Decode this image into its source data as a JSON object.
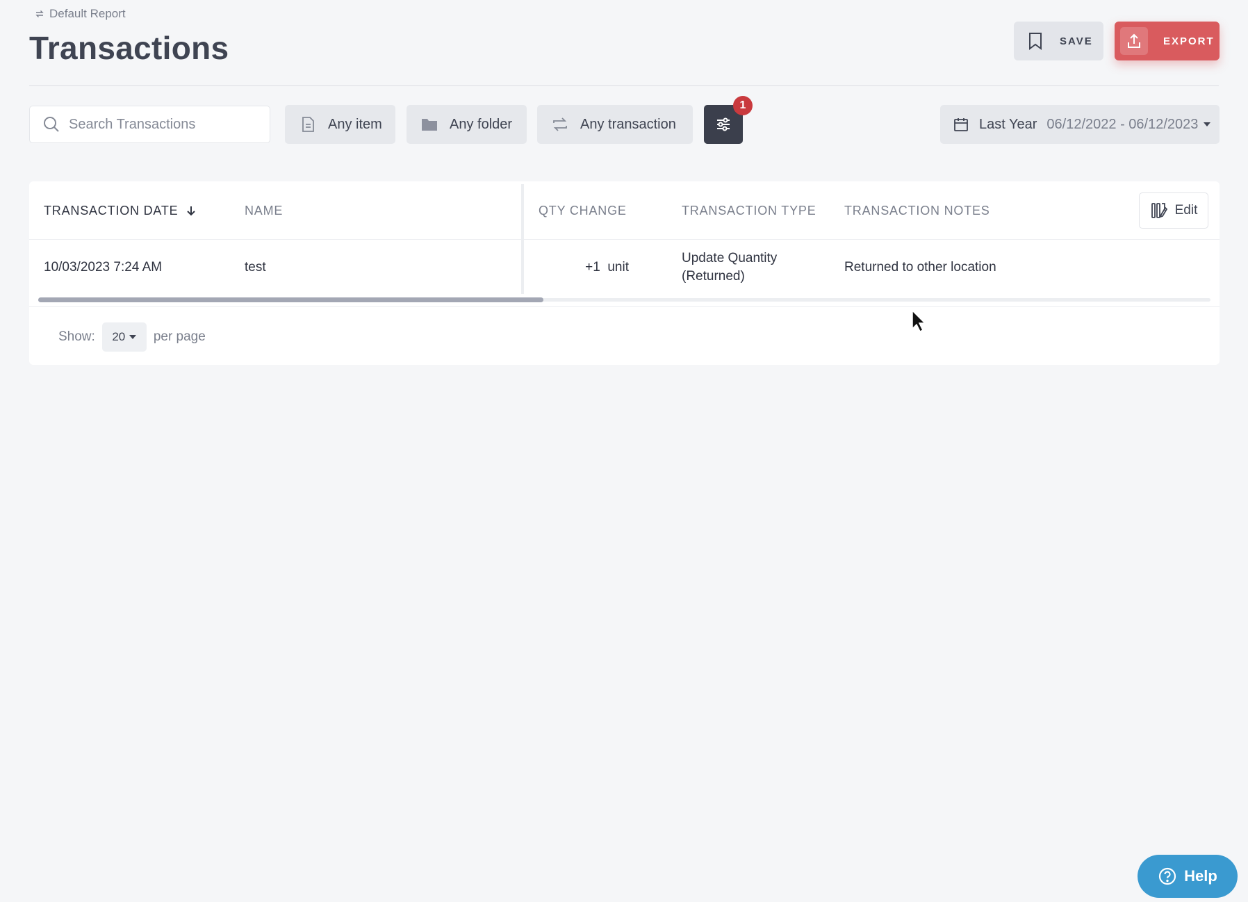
{
  "breadcrumb": {
    "icon": "refresh-icon",
    "label": "Default Report"
  },
  "page": {
    "title": "Transactions"
  },
  "actions": {
    "save_label": "SAVE",
    "export_label": "EXPORT",
    "export_color": "#d95b5e"
  },
  "filters": {
    "search_placeholder": "Search Transactions",
    "search_value": "",
    "item_label": "Any item",
    "folder_label": "Any folder",
    "transaction_label": "Any transaction",
    "active_filter_count": "1",
    "date_label": "Last Year",
    "date_range": "06/12/2022 - 06/12/2023"
  },
  "table": {
    "columns": [
      {
        "label": "TRANSACTION DATE",
        "sorted": "desc"
      },
      {
        "label": "NAME"
      },
      {
        "label": "QTY CHANGE"
      },
      {
        "label": "TRANSACTION TYPE"
      },
      {
        "label": "TRANSACTION NOTES"
      }
    ],
    "edit_label": "Edit",
    "rows": [
      {
        "date": "10/03/2023 7:24 AM",
        "name": "test",
        "qty_change": "+1  unit",
        "type_line1": "Update Quantity",
        "type_line2": "(Returned)",
        "notes": "Returned to other location"
      }
    ],
    "horizontal_scroll_fraction": 0.43
  },
  "pagination": {
    "show_label": "Show:",
    "page_size": "20",
    "per_page_label": "per page"
  },
  "help": {
    "label": "Help",
    "color": "#3a9ad0"
  }
}
